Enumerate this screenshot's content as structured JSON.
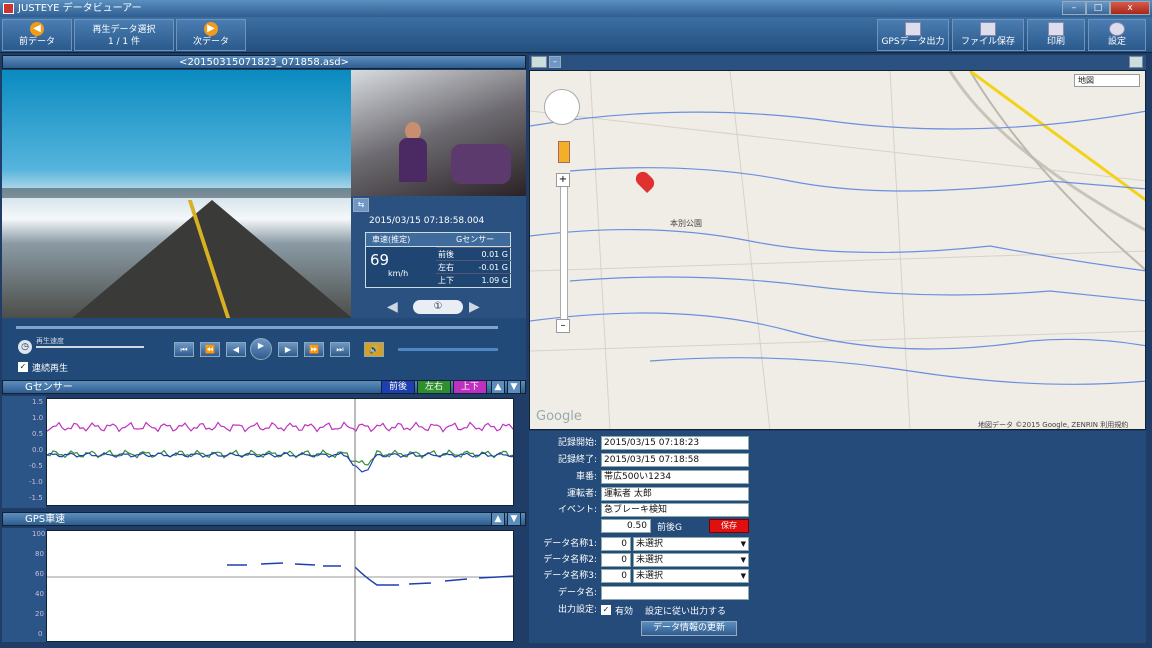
{
  "window": {
    "title": "JUSTEYE データビューアー",
    "min": "–",
    "max": "□",
    "close": "x"
  },
  "toolbar": {
    "prev_label": "前データ",
    "data_select_label": "再生データ選択",
    "data_count": "1 / 1 件",
    "next_label": "次データ",
    "right_buttons": [
      "GPSデータ出力",
      "ファイル保存",
      "印刷",
      "設定"
    ]
  },
  "video": {
    "filename": "<20150315071823_071858.asd>",
    "datetime": "2015/03/15 07:18:58.004",
    "speed_header": "車速(推定)",
    "g_header": "Gセンサー",
    "speed_value": "69",
    "speed_unit": "km/h",
    "g_rows": [
      {
        "label": "前後",
        "value": "0.01 G"
      },
      {
        "label": "左右",
        "value": "-0.01 G"
      },
      {
        "label": "上下",
        "value": "1.09 G"
      }
    ],
    "center_symbol": "①"
  },
  "controls": {
    "speed_label": "再生速度",
    "loop_label": "連続再生",
    "loop_checked": true,
    "buttons": [
      "⏮",
      "⏪",
      "◀",
      "▶",
      "▶",
      "⏩",
      "⏭"
    ],
    "volume_icon": "🔊"
  },
  "gsensor": {
    "title": "Gセンサー",
    "legend": [
      "前後",
      "左右",
      "上下"
    ],
    "legend_colors": [
      "#1f3fb0",
      "#2f8f2f",
      "#c030c0"
    ],
    "y_ticks": [
      "1.5",
      "1.0",
      "0.5",
      "0.0",
      "-0.5",
      "-1.0",
      "-1.5"
    ]
  },
  "gps": {
    "title": "GPS車速",
    "y_ticks": [
      "100",
      "80",
      "60",
      "40",
      "20",
      "0"
    ]
  },
  "map": {
    "type_select": "地図",
    "place_label": "本別公園",
    "google_label": "Google",
    "attribution": "地図データ ©2015 Google, ZENRIN 利用規約"
  },
  "form": {
    "rows": [
      {
        "label": "記録開始:",
        "value": "2015/03/15 07:18:23"
      },
      {
        "label": "記録終了:",
        "value": "2015/03/15 07:18:58"
      },
      {
        "label": "車番:",
        "value": "帯広500い1234"
      },
      {
        "label": "運転者:",
        "value": "運転者 太郎"
      },
      {
        "label": "イベント:",
        "value": "急ブレーキ検知"
      }
    ],
    "threshold_value": "0.50",
    "threshold_unit": "前後G",
    "record_button": "保存",
    "memo_rows": [
      {
        "label": "データ名称1:",
        "num": "0",
        "option": "未選択"
      },
      {
        "label": "データ名称2:",
        "num": "0",
        "option": "未選択"
      },
      {
        "label": "データ名称3:",
        "num": "0",
        "option": "未選択"
      }
    ],
    "note_label": "データ名:",
    "note_value": "",
    "output_label": "出力設定:",
    "output_checkbox": "有効",
    "output_text": "設定に従い出力する",
    "update_button": "データ情報の更新"
  }
}
